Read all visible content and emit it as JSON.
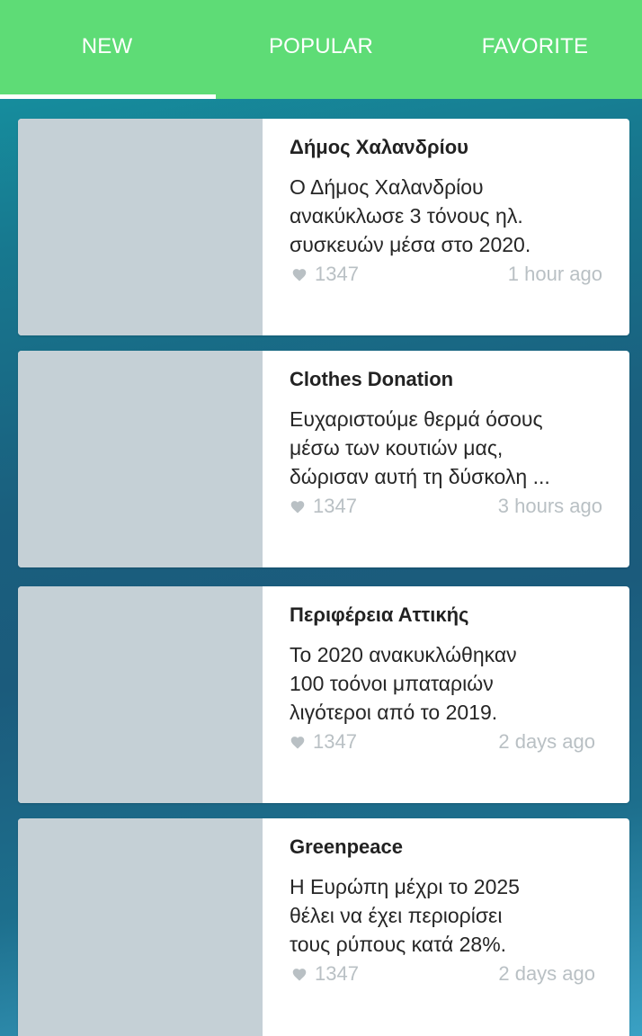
{
  "tabs": [
    {
      "label": "NEW",
      "active": true
    },
    {
      "label": "POPULAR",
      "active": false
    },
    {
      "label": "FAVORITE",
      "active": false
    }
  ],
  "colors": {
    "tab_bar": "#5edc76",
    "thumbnail_placeholder": "#c5d0d6",
    "meta_text": "#b9c0c4"
  },
  "cards": [
    {
      "title": "Δήμος Χαλανδρίου",
      "text": "Ο Δήμος Χαλανδρίου\nανακύκλωσε 3 τόνους ηλ.\nσυσκευών μέσα στο 2020.",
      "likes": "1347",
      "time": "1 hour ago",
      "like_icon": "heart-icon"
    },
    {
      "title": "Clothes Donation",
      "text": "Ευχαριστούμε θερμά όσους\nμέσω των κουτιών μας,\nδώρισαν αυτή τη δύσκολη ...",
      "likes": "1347",
      "time": "3 hours ago",
      "like_icon": "heart-icon"
    },
    {
      "title": "Περιφέρεια Αττικής",
      "text": "Το 2020 ανακυκλώθηκαν\n100 τοόνοι μπαταριών\nλιγότεροι από το 2019.",
      "likes": "1347",
      "time": "2 days ago",
      "like_icon": "heart-icon"
    },
    {
      "title": "Greenpeace",
      "text": "Η Ευρώπη μέχρι το 2025\nθέλει να έχει περιορίσει\nτους ρύπους κατά 28%.",
      "likes": "1347",
      "time": "2 days ago",
      "like_icon": "heart-icon"
    }
  ]
}
